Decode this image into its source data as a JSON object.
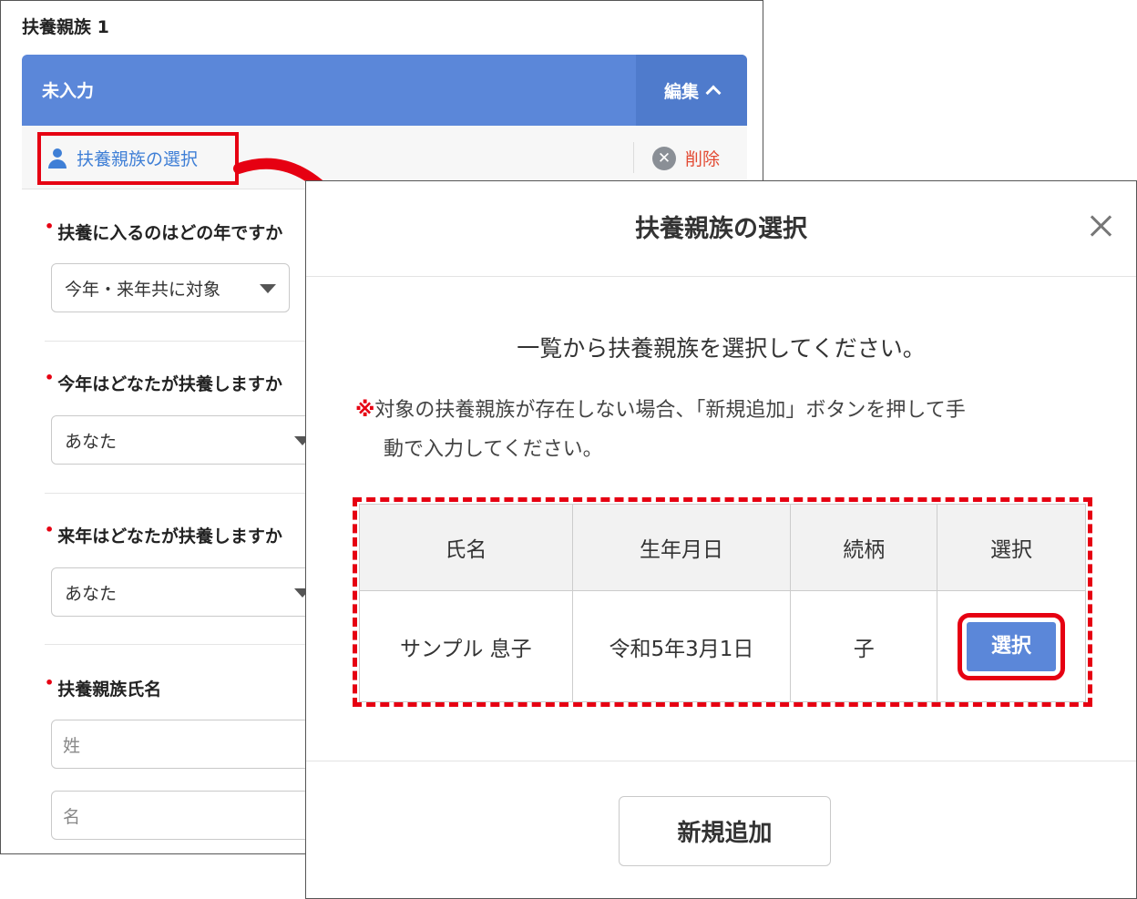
{
  "form": {
    "section_title": "扶養親族 1",
    "status": "未入力",
    "edit_label": "編集",
    "select_family_label": "扶養親族の選択",
    "delete_label": "削除",
    "required_mark": "•",
    "q_year_label": "扶養に入るのはどの年ですか",
    "q_year_value": "今年・来年共に対象",
    "q_this_year_label": "今年はどなたが扶養しますか",
    "q_this_year_value": "あなた",
    "q_next_year_label": "来年はどなたが扶養しますか",
    "q_next_year_value": "あなた",
    "name_label": "扶養親族氏名",
    "last_name_placeholder": "姓",
    "first_name_placeholder": "名"
  },
  "modal": {
    "title": "扶養親族の選択",
    "instruction": "一覧から扶養親族を選択してください。",
    "note_mark": "※",
    "note_line1": "対象の扶養親族が存在しない場合、「新規追加」ボタンを押して手",
    "note_line2": "動で入力してください。",
    "columns": [
      "氏名",
      "生年月日",
      "続柄",
      "選択"
    ],
    "rows": [
      {
        "name": "サンプル 息子",
        "birthdate": "令和5年3月1日",
        "relation": "子",
        "select_label": "選択"
      }
    ],
    "add_new_label": "新規追加"
  },
  "colors": {
    "accent_blue": "#5b87d9",
    "highlight_red": "#e60012",
    "delete_red": "#e34a33"
  }
}
